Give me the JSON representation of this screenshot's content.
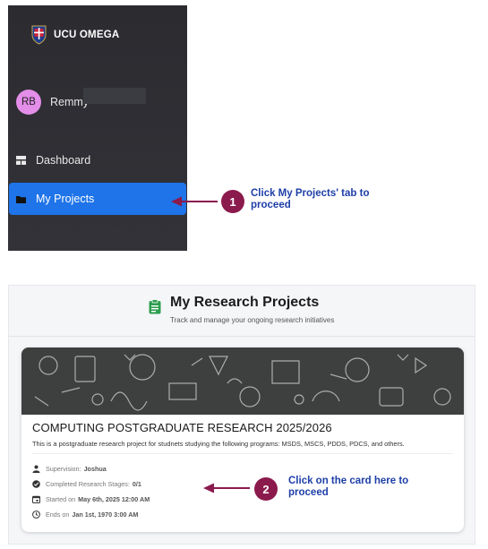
{
  "sidebar": {
    "brand_name": "UCU OMEGA",
    "user": {
      "initials": "RB",
      "name": "Remmy"
    },
    "nav": [
      {
        "label": "Dashboard",
        "icon": "dashboard-icon",
        "active": false
      },
      {
        "label": "My Projects",
        "icon": "folder-icon",
        "active": true
      }
    ]
  },
  "annotations": [
    {
      "number": "1",
      "line1": "Click My Projects' tab to",
      "line2": "proceed"
    },
    {
      "number": "2",
      "line1": "Click on the card here to",
      "line2": "proceed"
    }
  ],
  "research": {
    "title": "My Research Projects",
    "subtitle": "Track and manage your ongoing research initiatives",
    "card": {
      "title": "COMPUTING POSTGRADUATE RESEARCH 2025/2026",
      "description": "This is a postgraduate research project for studnets studying the following programs: MSDS, MSCS, PDDS, PDCS, and others.",
      "supervision_label": "Supervision:",
      "supervision_value": "Joshua",
      "stages_label": "Completed Research Stages:",
      "stages_value": "0/1",
      "started_label": "Started on",
      "started_value": "May 6th, 2025 12:00 AM",
      "ends_label": "Ends on",
      "ends_value": "Jan 1st, 1970 3:00 AM"
    }
  },
  "colors": {
    "sidebar_bg": "#2e2e33",
    "active_tab": "#1e74e8",
    "avatar_bg": "#e38ee9",
    "step_circle": "#8b1a4d",
    "annotation_text": "#1e3fa8",
    "arrow": "#8b1a4d",
    "clipboard_icon": "#2e9e4f"
  }
}
